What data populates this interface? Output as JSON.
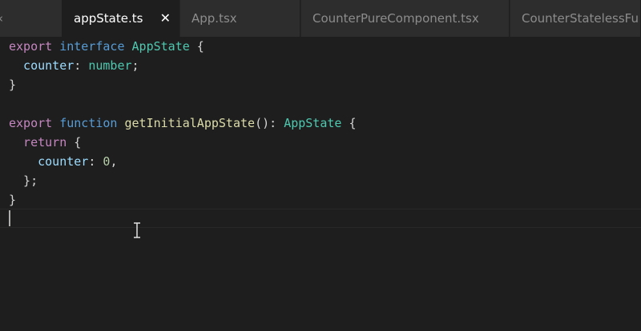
{
  "tabs": [
    {
      "label": "‹",
      "partial": true
    },
    {
      "label": "appState.ts",
      "active": true,
      "close": "✕"
    },
    {
      "label": "App.tsx"
    },
    {
      "label": "CounterPureComponent.tsx"
    },
    {
      "label": "CounterStatelessFu"
    }
  ],
  "code": {
    "l1": {
      "a": "export",
      "b": " interface ",
      "c": "AppState",
      "d": " {"
    },
    "l2": {
      "a": "  counter",
      "b": ": ",
      "c": "number",
      "d": ";"
    },
    "l3": {
      "a": "}"
    },
    "l5": {
      "a": "export",
      "b": " function ",
      "c": "getInitialAppState",
      "d": "(): ",
      "e": "AppState",
      "f": " {"
    },
    "l6": {
      "a": "  return",
      "b": " {"
    },
    "l7": {
      "a": "    counter",
      "b": ": ",
      "c": "0",
      "d": ","
    },
    "l8": {
      "a": "  };"
    },
    "l9": {
      "a": "}"
    }
  },
  "colors": {
    "background": "#1e1e1e",
    "keyword": "#c586c0",
    "storage": "#569cd6",
    "type": "#4ec9b0",
    "function": "#dcdcaa",
    "property": "#9cdcfe",
    "number": "#b5cea8"
  }
}
